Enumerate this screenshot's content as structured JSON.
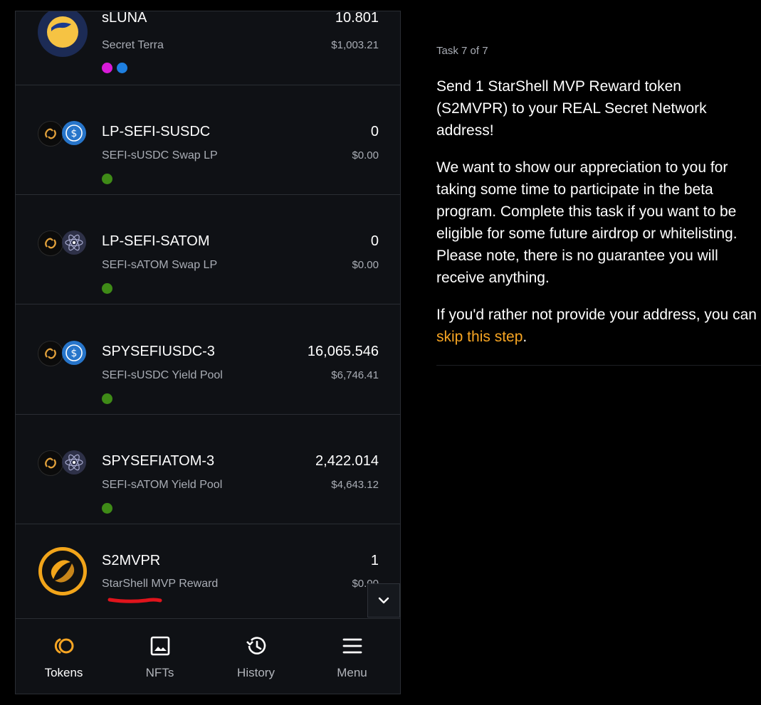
{
  "tokens": [
    {
      "symbol": "sLUNA",
      "name": "Secret Terra",
      "amount": "10.801",
      "fiat": "$1,003.21",
      "dots": [
        "#d81bd8",
        "#1e7fe0"
      ]
    },
    {
      "symbol": "LP-SEFI-SUSDC",
      "name": "SEFI-sUSDC Swap LP",
      "amount": "0",
      "fiat": "$0.00",
      "dots": [
        "#3f8b17"
      ]
    },
    {
      "symbol": "LP-SEFI-SATOM",
      "name": "SEFI-sATOM Swap LP",
      "amount": "0",
      "fiat": "$0.00",
      "dots": [
        "#3f8b17"
      ]
    },
    {
      "symbol": "SPYSEFIUSDC-3",
      "name": "SEFI-sUSDC Yield Pool",
      "amount": "16,065.546",
      "fiat": "$6,746.41",
      "dots": [
        "#3f8b17"
      ]
    },
    {
      "symbol": "SPYSEFIATOM-3",
      "name": "SEFI-sATOM Yield Pool",
      "amount": "2,422.014",
      "fiat": "$4,643.12",
      "dots": [
        "#3f8b17"
      ]
    },
    {
      "symbol": "S2MVPR",
      "name": "StarShell MVP Reward",
      "amount": "1",
      "fiat": "$0.00",
      "dots": []
    }
  ],
  "nav": [
    {
      "label": "Tokens",
      "icon": "tokens-icon",
      "active": true
    },
    {
      "label": "NFTs",
      "icon": "image-icon",
      "active": false
    },
    {
      "label": "History",
      "icon": "history-icon",
      "active": false
    },
    {
      "label": "Menu",
      "icon": "menu-icon",
      "active": false
    }
  ],
  "task": {
    "label": "Task 7 of 7",
    "p1": "Send 1 StarShell MVP Reward token (S2MVPR) to your REAL Secret Network address!",
    "p2": "We want to show our appreciation to you for taking some time to participate in the beta program. Complete this task if you want to be eligible for some future airdrop or whitelisting. Please note, there is no guarantee you will receive anything.",
    "p3_pre": "If you'd rather not provide your address, you can ",
    "skip_link": "skip this step",
    "p3_post": "."
  },
  "colors": {
    "accent": "#f7a523",
    "annotation": "#e0141c",
    "status_green": "#3f8b17"
  }
}
